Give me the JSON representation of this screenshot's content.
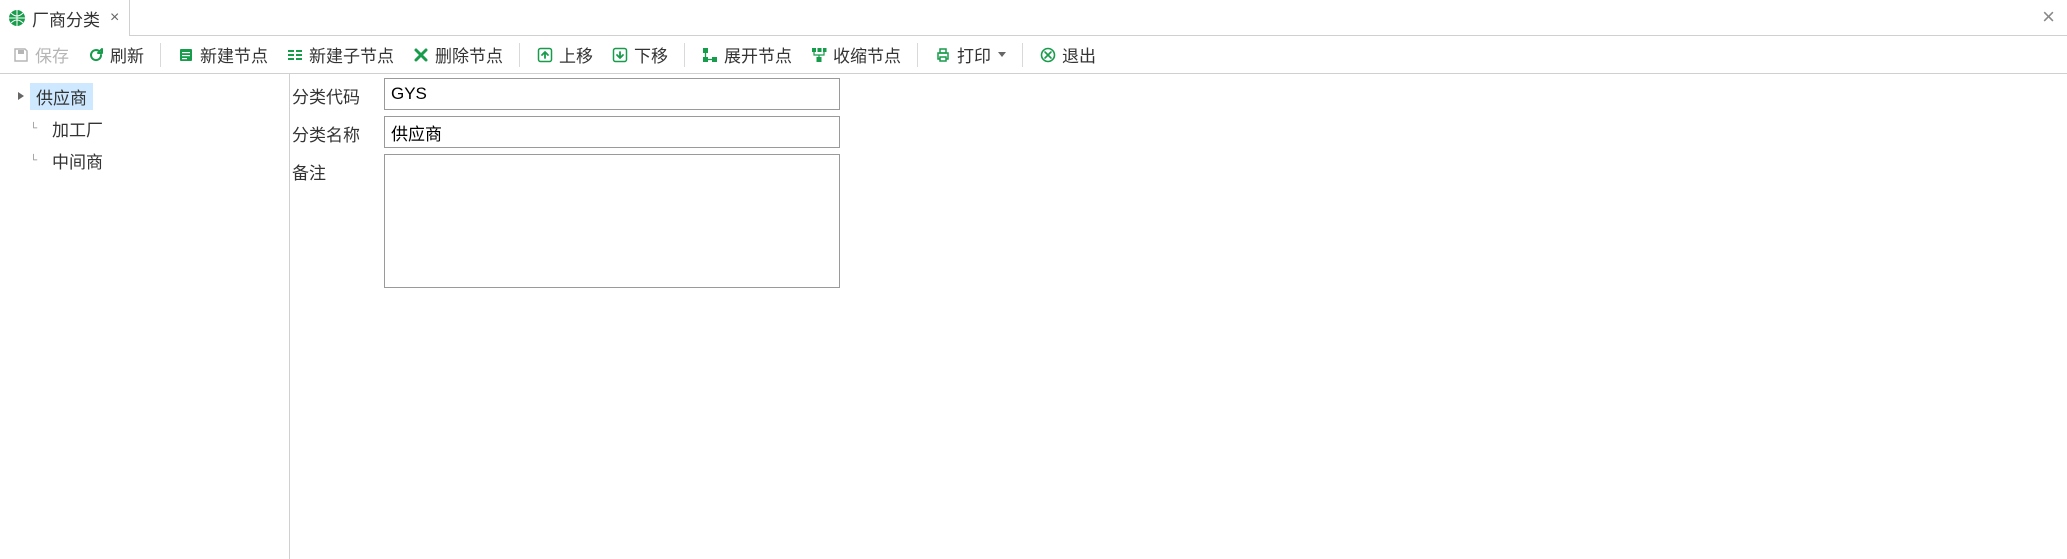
{
  "tab": {
    "title": "厂商分类",
    "icon": "globe-icon"
  },
  "toolbar": {
    "save": "保存",
    "refresh": "刷新",
    "new_node": "新建节点",
    "new_child_node": "新建子节点",
    "delete_node": "删除节点",
    "move_up": "上移",
    "move_down": "下移",
    "expand_node": "展开节点",
    "collapse_node": "收缩节点",
    "print": "打印",
    "exit": "退出"
  },
  "tree": {
    "items": [
      {
        "label": "供应商",
        "expandable": true,
        "selected": true
      },
      {
        "label": "加工厂",
        "expandable": false,
        "selected": false
      },
      {
        "label": "中间商",
        "expandable": false,
        "selected": false
      }
    ]
  },
  "form": {
    "code_label": "分类代码",
    "code_value": "GYS",
    "name_label": "分类名称",
    "name_value": "供应商",
    "remark_label": "备注",
    "remark_value": ""
  },
  "colors": {
    "accent_green": "#169c4a",
    "selection_blue": "#cde8ff"
  }
}
